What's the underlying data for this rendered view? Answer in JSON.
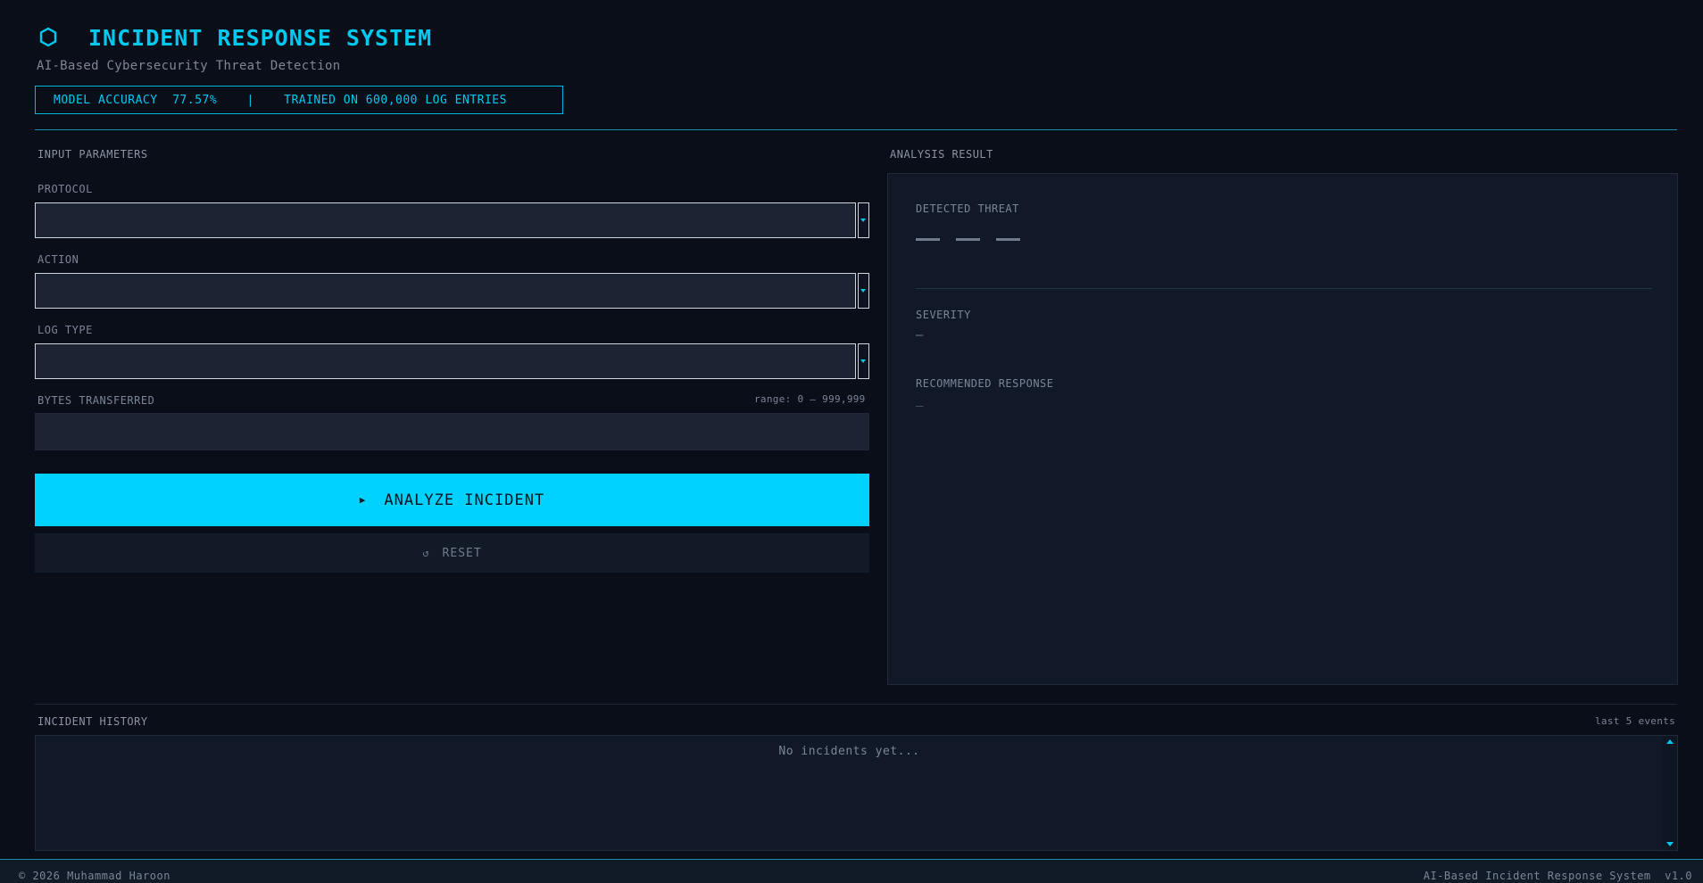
{
  "app": {
    "title": "INCIDENT RESPONSE SYSTEM",
    "subtitle": "AI-Based Cybersecurity Threat Detection",
    "logo_icon": "hexagon-icon",
    "accent_color": "#00d2ff"
  },
  "stats": {
    "text": "MODEL ACCURACY  77.57%    |    TRAINED ON 600,000 LOG ENTRIES"
  },
  "input": {
    "section_label": "INPUT PARAMETERS",
    "protocol_label": "PROTOCOL",
    "protocol_value": "",
    "action_label": "ACTION",
    "action_value": "",
    "log_type_label": "LOG TYPE",
    "log_type_value": "",
    "bytes_label": "BYTES TRANSFERRED",
    "bytes_range": "range: 0 – 999,999",
    "bytes_value": ""
  },
  "buttons": {
    "analyze_icon": "▶",
    "analyze_label": "ANALYZE INCIDENT",
    "reset_icon": "↺",
    "reset_label": "RESET"
  },
  "result": {
    "section_label": "ANALYSIS RESULT",
    "detected_threat_label": "DETECTED THREAT",
    "severity_label": "SEVERITY",
    "severity_value": "—",
    "response_label": "RECOMMENDED RESPONSE",
    "response_value": "_"
  },
  "history": {
    "section_label": "INCIDENT HISTORY",
    "count_label": "last 5 events",
    "empty_text": "No incidents yet..."
  },
  "footer": {
    "left": "© 2026 Muhammad Haroon",
    "right": "AI-Based Incident Response System  v1.0"
  }
}
